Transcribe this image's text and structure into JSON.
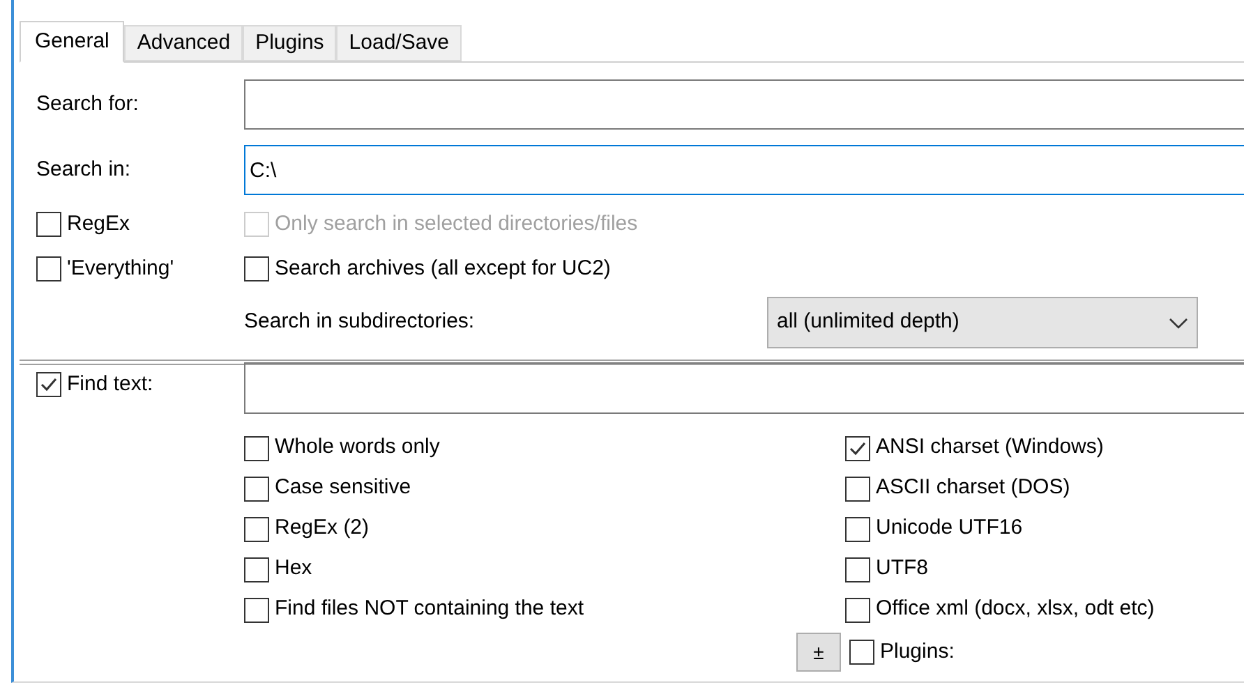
{
  "tabs": [
    {
      "label": "General",
      "selected": true
    },
    {
      "label": "Advanced",
      "selected": false
    },
    {
      "label": "Plugins",
      "selected": false
    },
    {
      "label": "Load/Save",
      "selected": false
    }
  ],
  "search_for": {
    "label": "Search for:"
  },
  "search_in": {
    "label": "Search in:",
    "value": "C:\\",
    "focused": true
  },
  "regex": {
    "label": "RegEx",
    "checked": false
  },
  "only_selected": {
    "label": "Only search in selected directories/files",
    "checked": false,
    "disabled": true
  },
  "everything": {
    "label": "'Everything'",
    "checked": false
  },
  "search_archives": {
    "label": "Search archives (all except for UC2)",
    "checked": false
  },
  "subdirectories": {
    "label": "Search in subdirectories:",
    "value": "all (unlimited depth)"
  },
  "find_text": {
    "label": "Find text:",
    "checked": true
  },
  "text_options": [
    {
      "label": "Whole words only",
      "checked": false
    },
    {
      "label": "Case sensitive",
      "checked": false
    },
    {
      "label": "RegEx (2)",
      "checked": false
    },
    {
      "label": "Hex",
      "checked": false
    },
    {
      "label": "Find files NOT containing the text",
      "checked": false
    }
  ],
  "charset_options": [
    {
      "label": "ANSI charset (Windows)",
      "checked": true
    },
    {
      "label": "ASCII charset (DOS)",
      "checked": false
    },
    {
      "label": "Unicode UTF16",
      "checked": false
    },
    {
      "label": "UTF8",
      "checked": false
    },
    {
      "label": "Office xml (docx, xlsx, odt etc)",
      "checked": false
    }
  ],
  "plus_button": {
    "label": "±"
  },
  "plugins": {
    "label": "Plugins:",
    "checked": false
  }
}
